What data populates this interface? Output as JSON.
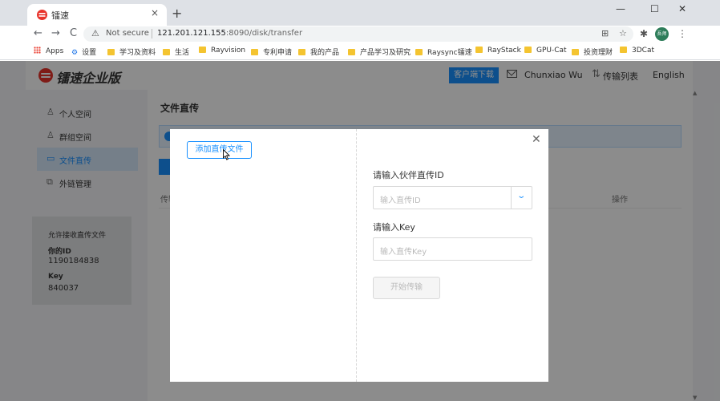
{
  "browser": {
    "tab_title": "镭速",
    "tab_close": "×",
    "new_tab": "+",
    "window_controls": {
      "minimize": "—",
      "maximize": "☐",
      "close": "✕"
    },
    "nav": {
      "back": "←",
      "forward": "→",
      "reload": "C"
    },
    "security_label": "Not secure",
    "url_host": "121.201.121.155",
    "url_path": ":8090/disk/transfer",
    "profile_initials": "吾师",
    "bookmarks": [
      "Apps",
      "设置",
      "学习及资料",
      "生活",
      "Rayvision",
      "专利申请",
      "我的产品",
      "产品学习及研究",
      "Raysync镭速",
      "RayStack",
      "GPU-Cat",
      "投资理财",
      "3DCat"
    ]
  },
  "app": {
    "logo_text": "镭速企业版",
    "header": {
      "download_label": "客户端下载",
      "username": "Chunxiao Wu",
      "transfer_list_label": "传输列表",
      "language_label": "English"
    },
    "sidebar": {
      "items": [
        {
          "label": "个人空间",
          "icon": "user-icon",
          "glyph": "♙"
        },
        {
          "label": "群组空间",
          "icon": "group-icon",
          "glyph": "♙"
        },
        {
          "label": "文件直传",
          "icon": "monitor-icon",
          "glyph": "▭"
        },
        {
          "label": "外链管理",
          "icon": "copy-link-icon",
          "glyph": "⧉"
        }
      ],
      "active_index": 2,
      "receive_card": {
        "title": "允许接收直传文件",
        "id_label": "你的ID",
        "id_value": "1190184838",
        "key_label": "Key",
        "key_value": "840037"
      }
    },
    "main": {
      "page_title": "文件直传",
      "table_headers": {
        "first": "传输",
        "action": "操作"
      }
    }
  },
  "modal": {
    "add_file_label": "添加直传文件",
    "close_label": "✕",
    "partner_id_label": "请输入伙伴直传ID",
    "partner_id_placeholder": "输入直传ID",
    "key_label": "请输入Key",
    "key_placeholder": "输入直传Key",
    "start_label": "开始传输",
    "dropdown_chevron": "⌄"
  },
  "colors": {
    "primary": "#1890ff",
    "logo_red": "#e8332b",
    "overlay": "rgba(0,0,0,0.45)"
  }
}
